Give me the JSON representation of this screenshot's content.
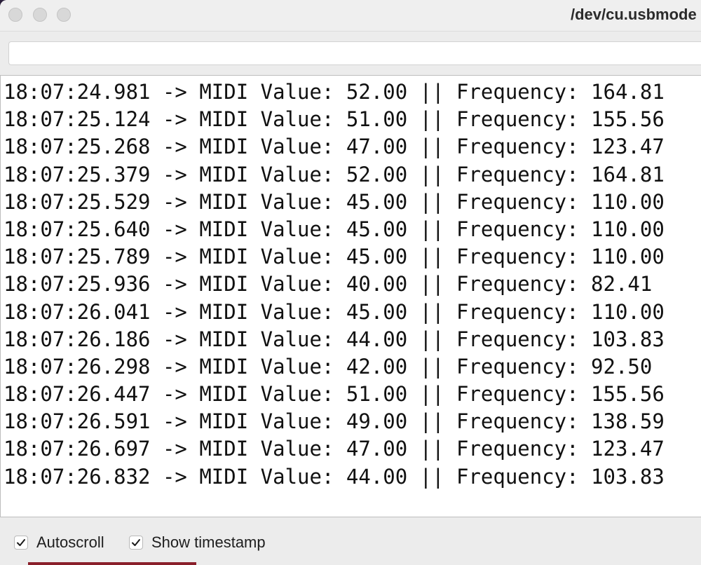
{
  "window": {
    "title": "/dev/cu.usbmode"
  },
  "send": {
    "value": "",
    "placeholder": ""
  },
  "output": {
    "lines": [
      "18:07:24.981 -> MIDI Value: 52.00 || Frequency: 164.81",
      "18:07:25.124 -> MIDI Value: 51.00 || Frequency: 155.56",
      "18:07:25.268 -> MIDI Value: 47.00 || Frequency: 123.47",
      "18:07:25.379 -> MIDI Value: 52.00 || Frequency: 164.81",
      "18:07:25.529 -> MIDI Value: 45.00 || Frequency: 110.00",
      "18:07:25.640 -> MIDI Value: 45.00 || Frequency: 110.00",
      "18:07:25.789 -> MIDI Value: 45.00 || Frequency: 110.00",
      "18:07:25.936 -> MIDI Value: 40.00 || Frequency: 82.41",
      "18:07:26.041 -> MIDI Value: 45.00 || Frequency: 110.00",
      "18:07:26.186 -> MIDI Value: 44.00 || Frequency: 103.83",
      "18:07:26.298 -> MIDI Value: 42.00 || Frequency: 92.50",
      "18:07:26.447 -> MIDI Value: 51.00 || Frequency: 155.56",
      "18:07:26.591 -> MIDI Value: 49.00 || Frequency: 138.59",
      "18:07:26.697 -> MIDI Value: 47.00 || Frequency: 123.47",
      "18:07:26.832 -> MIDI Value: 44.00 || Frequency: 103.83"
    ]
  },
  "footer": {
    "autoscroll": {
      "label": "Autoscroll",
      "checked": true,
      "icon": "checkmark-icon"
    },
    "show_timestamp": {
      "label": "Show timestamp",
      "checked": true,
      "icon": "checkmark-icon"
    }
  }
}
